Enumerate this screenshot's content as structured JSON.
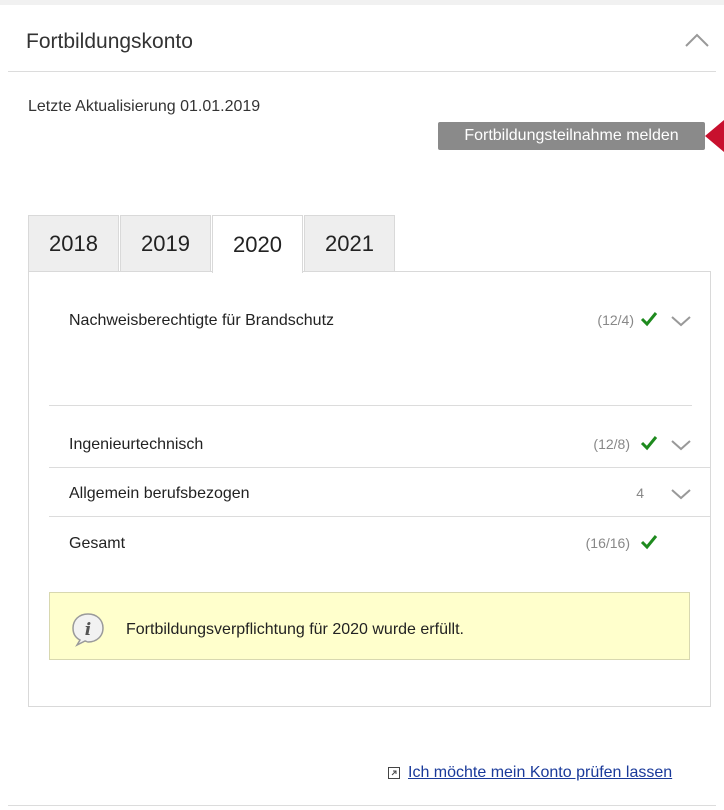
{
  "panel": {
    "title": "Fortbildungskonto",
    "collapse_icon": "chevron-up-icon"
  },
  "last_update": "Letzte Aktualisierung 01.01.2019",
  "report_button": "Fortbildungsteilnahme melden",
  "tabs": [
    {
      "label": "2018",
      "active": false
    },
    {
      "label": "2019",
      "active": false
    },
    {
      "label": "2020",
      "active": true
    },
    {
      "label": "2021",
      "active": false
    }
  ],
  "rows": [
    {
      "label": "Nachweisberechtigte für Brandschutz",
      "count": "(12/4)",
      "check": true,
      "expandable": true
    },
    {
      "label": "Ingenieurtechnisch",
      "count": "(12/8)",
      "check": true,
      "expandable": true
    },
    {
      "label": "Allgemein berufsbezogen",
      "count": "4",
      "check": false,
      "expandable": true
    },
    {
      "label": "Gesamt",
      "count": "(16/16)",
      "check": true,
      "expandable": false
    }
  ],
  "info": {
    "icon": "info-icon",
    "text": "Fortbildungsverpflichtung für 2020 wurde erfüllt."
  },
  "review_link": "Ich möchte mein Konto prüfen lassen",
  "colors": {
    "check": "#1e8a1e",
    "arrow": "#c8102e",
    "button_bg": "#8a8a8a",
    "info_bg": "#ffffcc",
    "link": "#1a3a9a"
  }
}
